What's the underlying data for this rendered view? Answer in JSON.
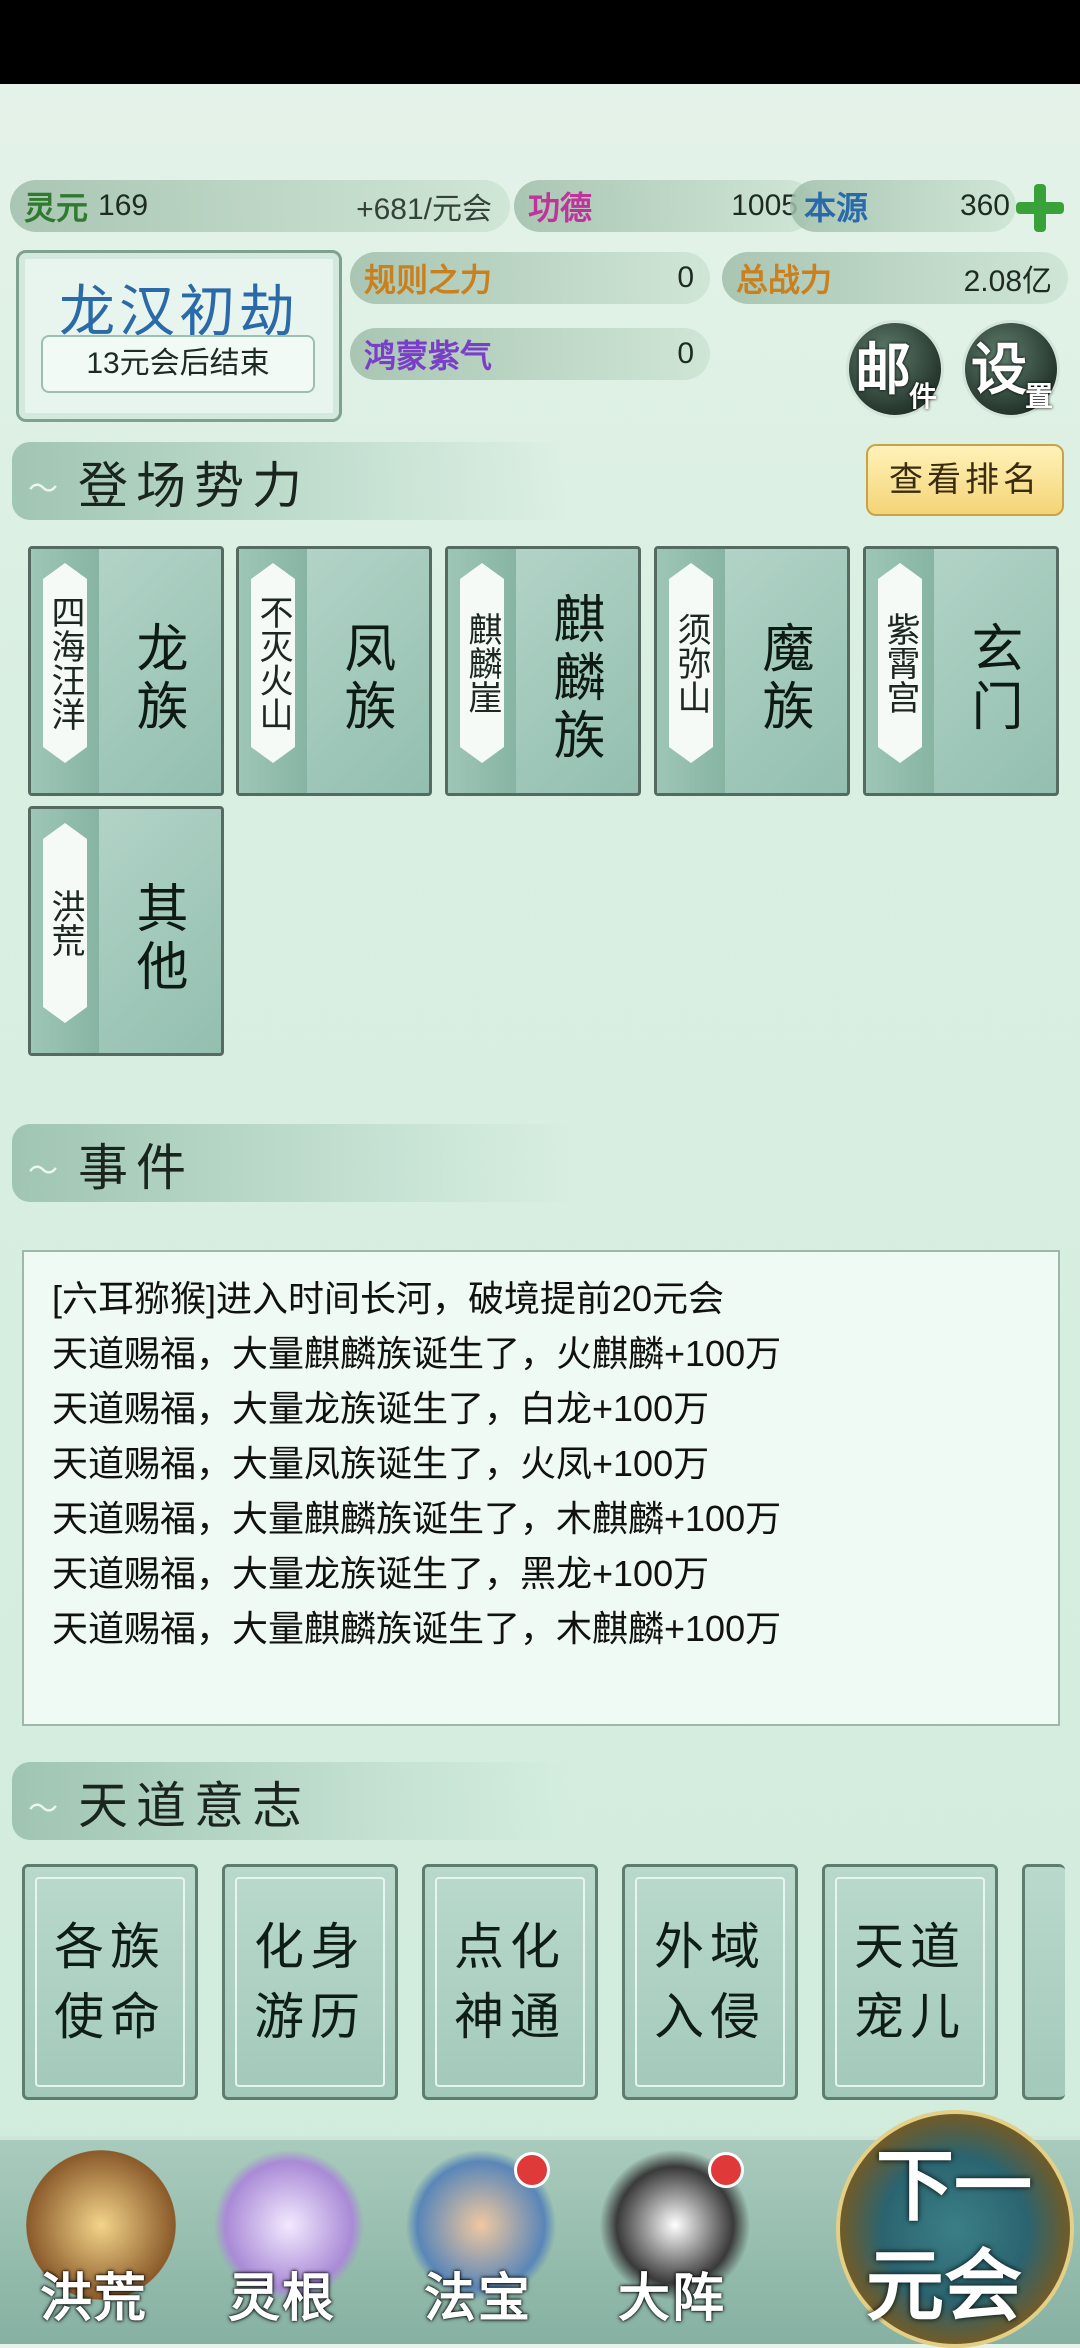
{
  "resources": {
    "lingyuan": {
      "label": "灵元",
      "value": "169",
      "gain": "+681/元会"
    },
    "gongde": {
      "label": "功德",
      "value": "1005"
    },
    "benyuan": {
      "label": "本源",
      "value": "360"
    },
    "guize": {
      "label": "规则之力",
      "value": "0"
    },
    "zhanli": {
      "label": "总战力",
      "value": "2.08亿"
    },
    "hongmeng": {
      "label": "鸿蒙紫气",
      "value": "0"
    }
  },
  "era": {
    "name": "龙汉初劫",
    "countdown": "13元会后结束"
  },
  "buttons": {
    "mail": {
      "big": "邮",
      "small": "件"
    },
    "settings": {
      "big": "设",
      "small": "置"
    }
  },
  "forces": {
    "title": "登场势力",
    "rank_button": "查看排名",
    "items": [
      {
        "place": "四海汪洋",
        "race": "龙族"
      },
      {
        "place": "不灭火山",
        "race": "凤族"
      },
      {
        "place": "麒麟崖",
        "race": "麒麟族"
      },
      {
        "place": "须弥山",
        "race": "魔族"
      },
      {
        "place": "紫霄宫",
        "race": "玄门"
      },
      {
        "place": "洪荒",
        "race": "其他"
      }
    ]
  },
  "events": {
    "title": "事件",
    "lines": [
      "[六耳猕猴]进入时间长河，破境提前20元会",
      "天道赐福，大量麒麟族诞生了，火麒麟+100万",
      "天道赐福，大量龙族诞生了，白龙+100万",
      "天道赐福，大量凤族诞生了，火凤+100万",
      "天道赐福，大量麒麟族诞生了，木麒麟+100万",
      "天道赐福，大量龙族诞生了，黑龙+100万",
      "天道赐福，大量麒麟族诞生了，木麒麟+100万"
    ]
  },
  "will": {
    "title": "天道意志",
    "cards": [
      {
        "l1": "各族",
        "l2": "使命"
      },
      {
        "l1": "化身",
        "l2": "游历"
      },
      {
        "l1": "点化",
        "l2": "神通"
      },
      {
        "l1": "外域",
        "l2": "入侵"
      },
      {
        "l1": "天道",
        "l2": "宠儿"
      }
    ]
  },
  "nav": {
    "tabs": [
      {
        "label": "洪荒",
        "icon": "mountain-icon"
      },
      {
        "label": "灵根",
        "icon": "lotus-icon"
      },
      {
        "label": "法宝",
        "icon": "treasure-icon"
      },
      {
        "label": "大阵",
        "icon": "formation-icon"
      }
    ],
    "next_line1": "下一",
    "next_line2": "元会"
  },
  "colors": {
    "accent_green": "#3aa03a",
    "badge_red": "#e0393a",
    "era_blue": "#2a6aa8"
  }
}
